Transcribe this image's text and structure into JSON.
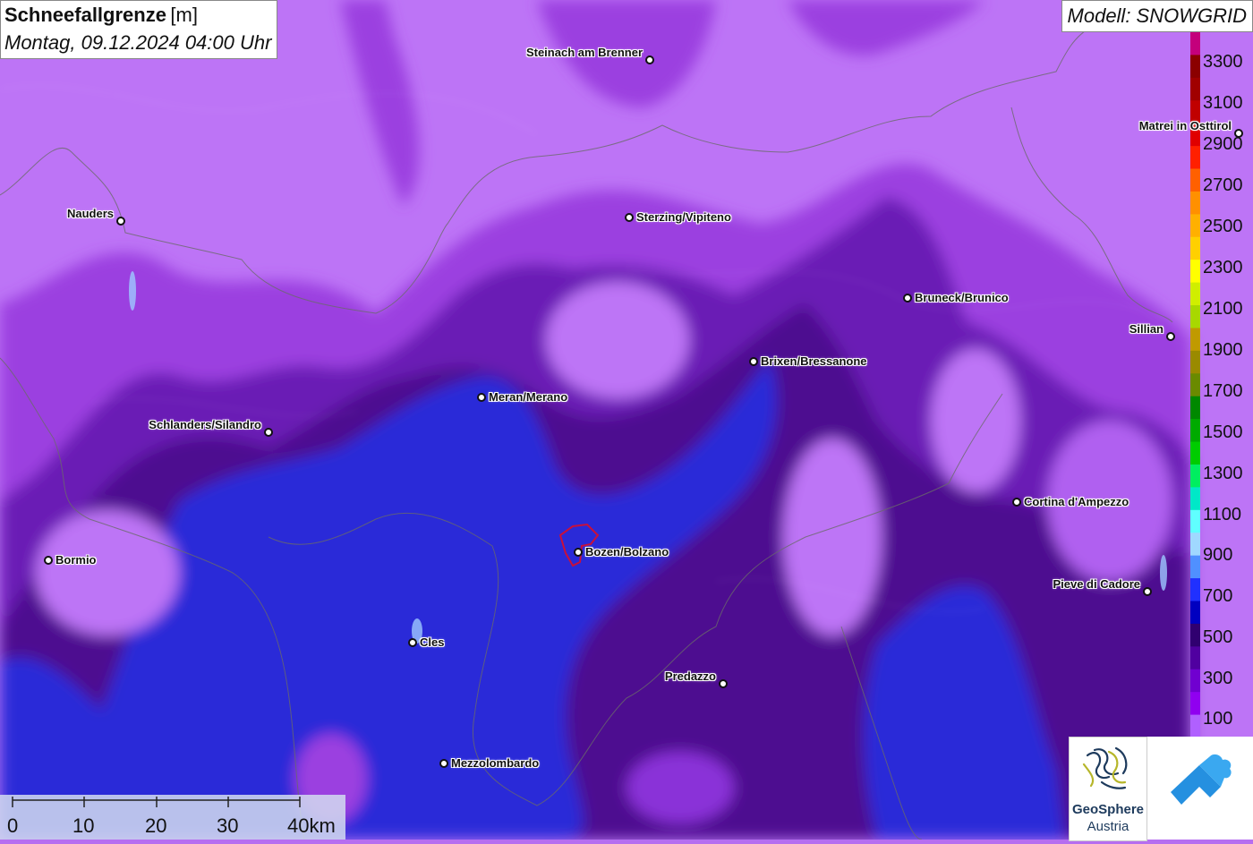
{
  "header": {
    "title": "Schneefallgrenze",
    "unit": "[m]",
    "datetime": "Montag, 09.12.2024 04:00 Uhr",
    "model": "Modell: SNOWGRID"
  },
  "legend": {
    "labels": [
      "3300",
      "3100",
      "2900",
      "2700",
      "2500",
      "2300",
      "2100",
      "1900",
      "1700",
      "1500",
      "1300",
      "1100",
      "900",
      "700",
      "500",
      "300",
      "100"
    ],
    "colors": [
      "#c4007c",
      "#8b0000",
      "#a00000",
      "#c00000",
      "#e00000",
      "#ff2000",
      "#ff6000",
      "#ff9000",
      "#ffb000",
      "#ffd000",
      "#ffff00",
      "#d0ee00",
      "#a8d800",
      "#c09a00",
      "#9a8a00",
      "#6a8a00",
      "#008800",
      "#00aa00",
      "#00cc00",
      "#00ee60",
      "#00e8c8",
      "#60ffff",
      "#a0d8ff",
      "#5090ff",
      "#2030ff",
      "#0000c0",
      "#300070",
      "#5000a0",
      "#7000d0",
      "#9000f0",
      "#b060ff"
    ]
  },
  "cities": [
    {
      "name": "Steinach am Brenner",
      "label_side": "left"
    },
    {
      "name": "Matrei in Osttirol",
      "label_side": "left"
    },
    {
      "name": "Nauders",
      "label_side": "left"
    },
    {
      "name": "Sterzing/Vipiteno",
      "label_side": "right"
    },
    {
      "name": "Bruneck/Brunico",
      "label_side": "right"
    },
    {
      "name": "Sillian",
      "label_side": "left"
    },
    {
      "name": "Brixen/Bressanone",
      "label_side": "right"
    },
    {
      "name": "Meran/Merano",
      "label_side": "right"
    },
    {
      "name": "Schlanders/Silandro",
      "label_side": "left"
    },
    {
      "name": "Cortina d'Ampezzo",
      "label_side": "right"
    },
    {
      "name": "Bormio",
      "label_side": "right"
    },
    {
      "name": "Bozen/Bolzano",
      "label_side": "right"
    },
    {
      "name": "Pieve di Cadore",
      "label_side": "left"
    },
    {
      "name": "Cles",
      "label_side": "right"
    },
    {
      "name": "Predazzo",
      "label_side": "left"
    },
    {
      "name": "Mezzolombardo",
      "label_side": "right"
    }
  ],
  "scale": {
    "labels": [
      "0",
      "10",
      "20",
      "30",
      "40km"
    ]
  },
  "logos": {
    "geosphere_line1": "GeoSphere",
    "geosphere_line2": "Austria"
  }
}
